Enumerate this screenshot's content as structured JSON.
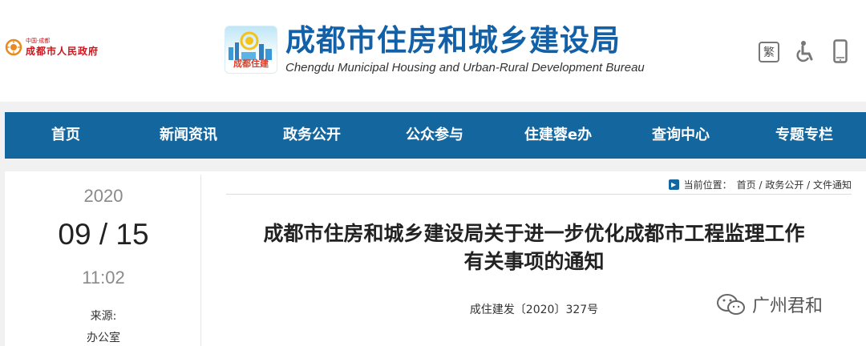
{
  "header": {
    "gov_small": "中国·成都",
    "gov_name": "成都市人民政府",
    "bureau_logo_label": "成都住建",
    "title": "成都市住房和城乡建设局",
    "subtitle": "Chengdu Municipal Housing and Urban-Rural Development Bureau",
    "traditional_label": "繁"
  },
  "nav": {
    "items": [
      {
        "label": "首页"
      },
      {
        "label": "新闻资讯"
      },
      {
        "label": "政务公开"
      },
      {
        "label": "公众参与"
      },
      {
        "label": "住建蓉e办"
      },
      {
        "label": "查询中心"
      },
      {
        "label": "专题专栏"
      }
    ]
  },
  "meta": {
    "year": "2020",
    "month_day": "09 / 15",
    "time": "11:02",
    "source_label": "来源:",
    "source_value": "办公室"
  },
  "breadcrumb": {
    "prefix": "当前位置：",
    "path": "首页 / 政务公开 / 文件通知"
  },
  "document": {
    "title_line1": "成都市住房和城乡建设局关于进一步优化成都市工程监理工作",
    "title_line2": "有关事项的通知",
    "number": "成住建发〔2020〕327号"
  },
  "watermark": {
    "text": "广州君和"
  },
  "colors": {
    "nav_bg": "#14669f",
    "title_blue": "#1261a8",
    "gov_red": "#c8171e"
  }
}
